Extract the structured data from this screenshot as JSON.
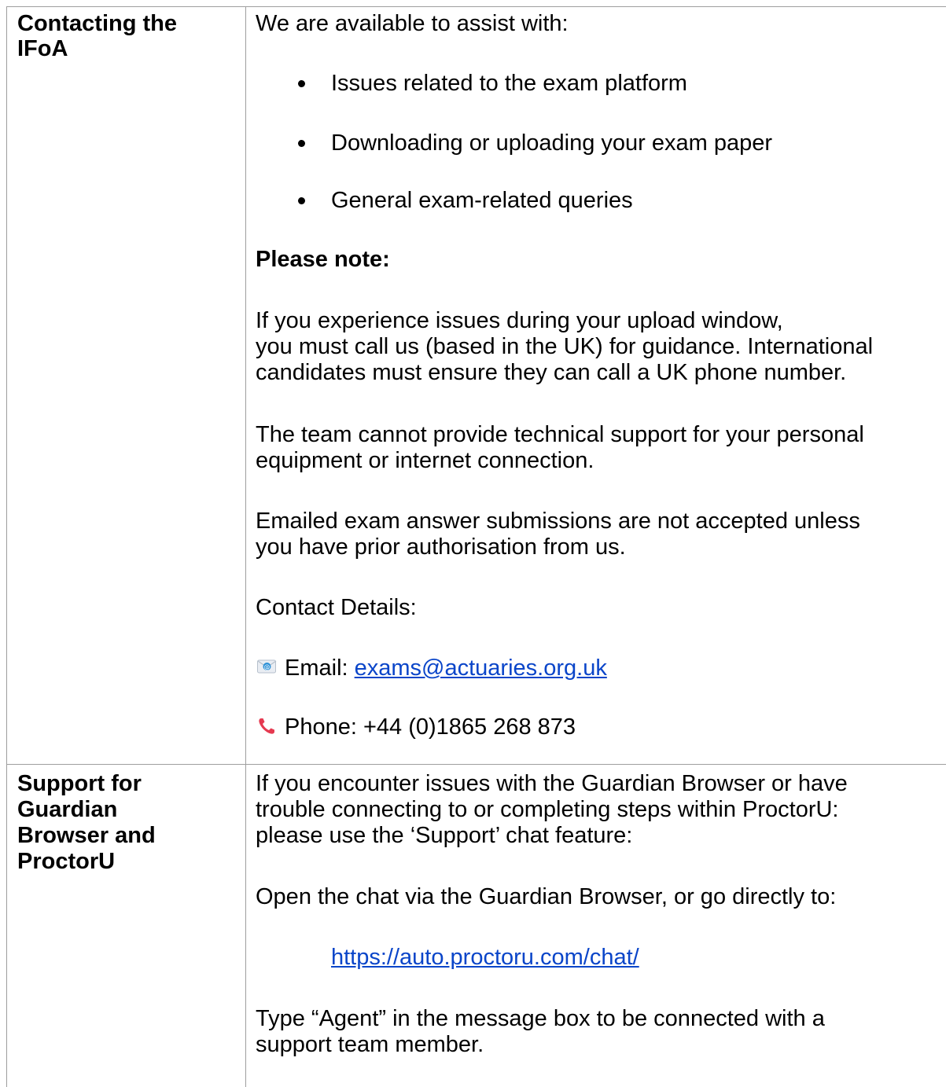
{
  "rows": [
    {
      "heading_lines": [
        "Contacting the",
        "IFoA"
      ],
      "intro": "We are available to assist with:",
      "bullets": [
        "Issues related to the exam platform",
        "Downloading or uploading your exam paper",
        "General exam-related queries"
      ],
      "note_heading": "Please note:",
      "para1_lines": [
        "If you experience issues during your upload window,",
        "you must call us (based in the UK) for guidance. International",
        "candidates must ensure they can call a UK phone number."
      ],
      "para2_lines": [
        "The team cannot provide technical support for your personal",
        "equipment or internet connection."
      ],
      "para3_lines": [
        "Emailed exam answer submissions are not accepted unless",
        "you have prior authorisation from us."
      ],
      "contact_heading": "Contact Details:",
      "email_label": "Email: ",
      "email_address": "exams@actuaries.org.uk",
      "phone_text": "Phone: +44 (0)1865 268 873"
    },
    {
      "heading_lines": [
        "Support for",
        "Guardian",
        "Browser and",
        "ProctorU"
      ],
      "para1_lines": [
        "If you encounter issues with the Guardian Browser or have",
        "trouble connecting to or completing steps within ProctorU:",
        "please use the ‘Support’ chat feature:"
      ],
      "para2": "Open the chat via the Guardian Browser, or go directly to:",
      "chat_url": "https://auto.proctoru.com/chat/",
      "para3_lines": [
        "Type “Agent” in the message box to be connected with a",
        "support team member."
      ]
    }
  ],
  "icons": {
    "email": "email-envelope-icon",
    "phone": "phone-handset-icon"
  },
  "colors": {
    "link": "#0a45c9",
    "grid": "#9e9e9e",
    "phone_icon": "#e53950",
    "email_icon": "#2a8fd6"
  }
}
